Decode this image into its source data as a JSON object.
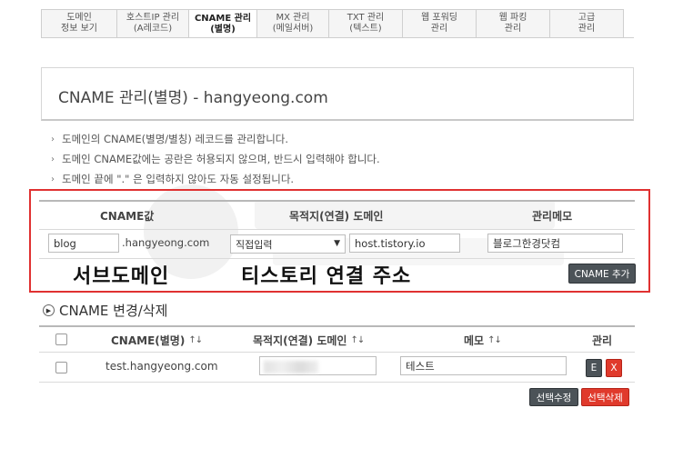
{
  "tabs": [
    {
      "line1": "도메인",
      "line2": "정보 보기"
    },
    {
      "line1": "호스트IP 관리",
      "line2": "(A레코드)"
    },
    {
      "line1": "CNAME 관리",
      "line2": "(별명)"
    },
    {
      "line1": "MX 관리",
      "line2": "(메일서버)"
    },
    {
      "line1": "TXT 관리",
      "line2": "(텍스트)"
    },
    {
      "line1": "웹 포워딩",
      "line2": "관리"
    },
    {
      "line1": "웹 파킹",
      "line2": "관리"
    },
    {
      "line1": "고급",
      "line2": "관리"
    }
  ],
  "title": "CNAME 관리(별명) - hangyeong.com",
  "notes": [
    "도메인의 CNAME(별명/별칭) 레코드를 관리합니다.",
    "도메인 CNAME값에는 공란은 허용되지 않으며, 반드시 입력해야 합니다.",
    "도메인 끝에 \".\" 은 입력하지 않아도 자동 설정됩니다."
  ],
  "note_bullet": "›",
  "add_form": {
    "col_cname": "CNAME값",
    "col_target": "목적지(연결) 도메인",
    "col_memo": "관리메모",
    "cname_value": "blog",
    "domain_suffix": ".hangyeong.com",
    "select_value": "직접입력",
    "target_value": "host.tistory.io",
    "memo_value": "블로그한경닷컴",
    "add_button": "CNAME 추가"
  },
  "annotations": {
    "subdomain": "서브도메인",
    "tistory": "티스토리 연결 주소"
  },
  "section_title": "CNAME 변경/삭제",
  "table": {
    "col_cname": "CNAME(별명)",
    "col_target": "목적지(연결) 도메인",
    "col_memo": "메모",
    "col_manage": "관리",
    "sort_arrows": "↑↓",
    "row": {
      "cname": "test.hangyeong.com",
      "memo": "테스트",
      "edit_label": "E",
      "delete_label": "X"
    }
  },
  "buttons": {
    "edit_selected": "선택수정",
    "delete_selected": "선택삭제"
  },
  "colors": {
    "highlight_border": "#e03131",
    "dark_button": "#4c5358",
    "red_button": "#e03a2c"
  }
}
